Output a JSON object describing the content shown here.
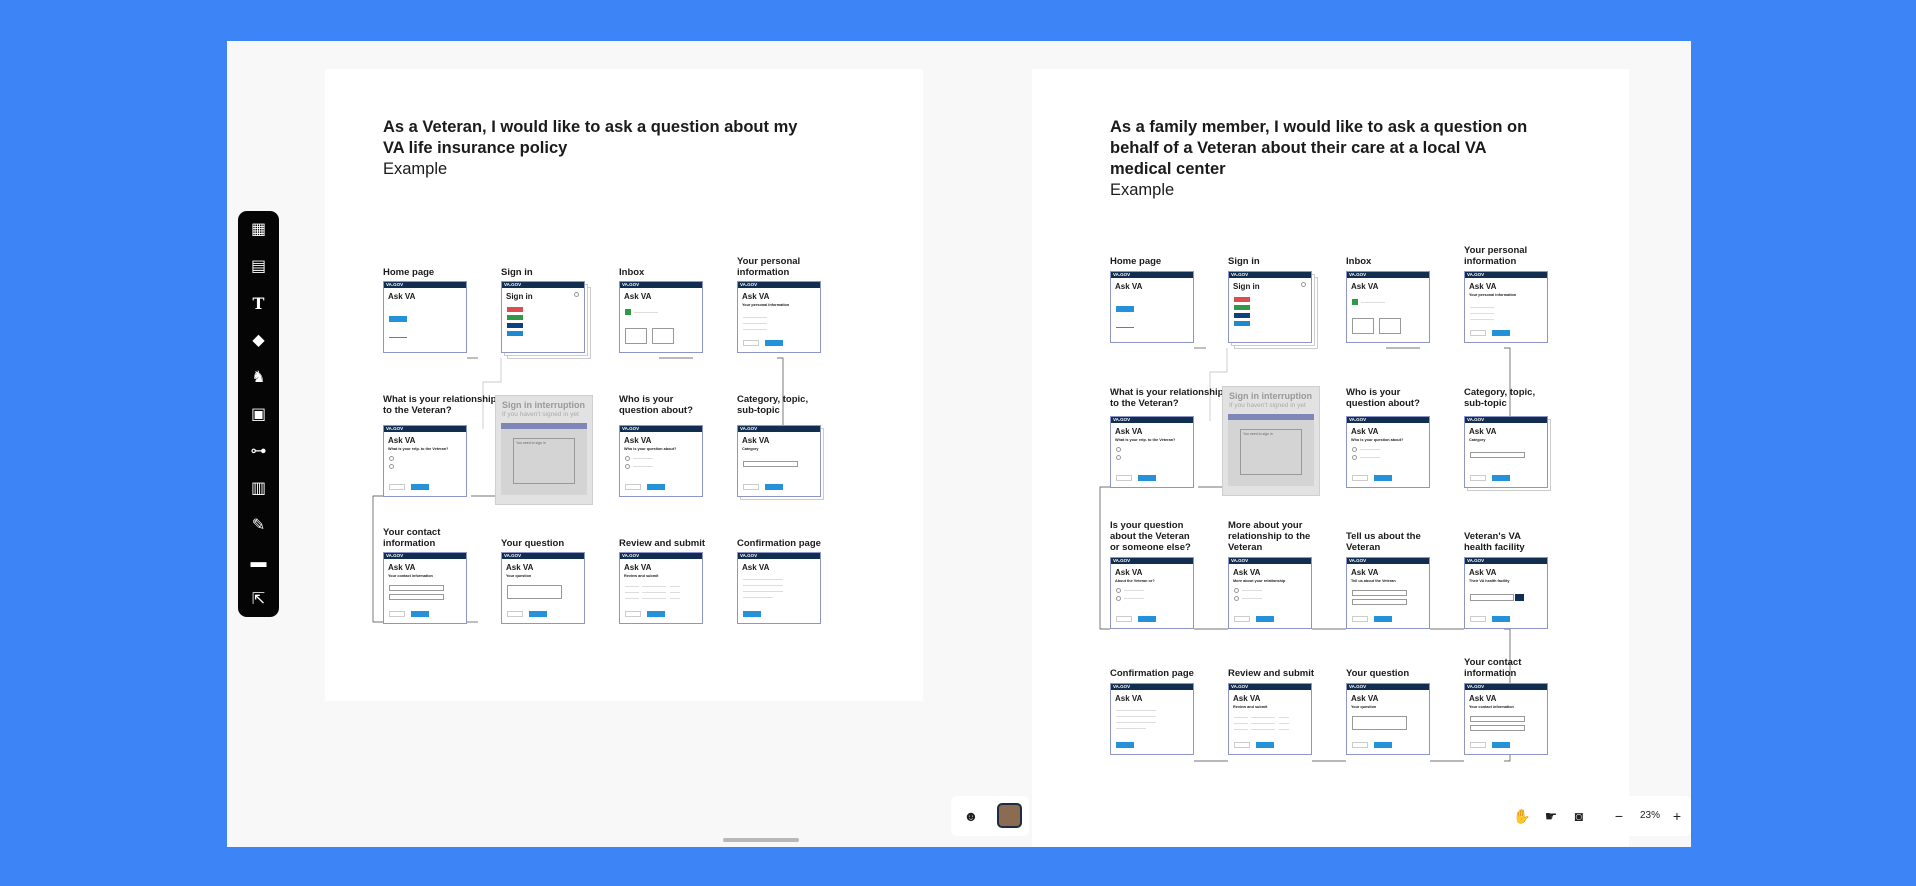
{
  "boards": {
    "left": {
      "title_line1": "As a Veteran, I would like to ask a question about my",
      "title_line2": "VA life insurance policy",
      "subtitle": "Example",
      "steps": {
        "home": "Home page",
        "signin": "Sign in",
        "inbox": "Inbox",
        "personal_1": "Your personal",
        "personal_2": "information",
        "relationship_1": "What is your relationship",
        "relationship_2": "to the Veteran?",
        "who_1": "Who is your",
        "who_2": "question about?",
        "category_1": "Category, topic,",
        "category_2": "sub-topic",
        "contact_1": "Your contact",
        "contact_2": "information",
        "question": "Your question",
        "review": "Review and submit",
        "confirmation": "Confirmation page"
      }
    },
    "right": {
      "title_line1": "As a family member, I would like to ask a question on",
      "title_line2": "behalf of a Veteran about their care at a local VA",
      "title_line3": "medical center",
      "subtitle": "Example",
      "steps": {
        "home": "Home page",
        "signin": "Sign in",
        "inbox": "Inbox",
        "personal_1": "Your personal",
        "personal_2": "information",
        "relationship_1": "What is your relationship",
        "relationship_2": "to the Veteran?",
        "who_1": "Who is your",
        "who_2": "question about?",
        "category_1": "Category, topic,",
        "category_2": "sub-topic",
        "about_1": "Is your question",
        "about_2": "about the Veteran",
        "about_3": "or someone else?",
        "more_1": "More about your",
        "more_2": "relationship to the",
        "more_3": "Veteran",
        "tell_1": "Tell us about the",
        "tell_2": "Veteran",
        "facility_1": "Veteran's VA",
        "facility_2": "health facility",
        "confirmation": "Confirmation page",
        "review": "Review and submit",
        "question": "Your question",
        "contact_1": "Your contact",
        "contact_2": "information"
      }
    }
  },
  "card": {
    "header": "VA.GOV",
    "title": "Ask VA",
    "signin_title": "Sign in",
    "sub_personal": "Your personal information",
    "sub_relationship": "What is your relp. to the Veteran?",
    "sub_who": "Who is your question about?",
    "sub_category": "Category",
    "sub_contact": "Your contact information",
    "sub_question": "Your question",
    "sub_review": "Review and submit",
    "sub_about": "About the Veteran or?",
    "sub_more": "More about your relationship",
    "sub_tell": "Tell us about the Veteran",
    "sub_facility": "Their VA health facility"
  },
  "interruption": {
    "title": "Sign in interruption",
    "subtitle": "If you haven't signed in yet",
    "note": "You need to sign in"
  },
  "toolbar": {
    "tools": [
      "templates-icon",
      "sticky-note-icon",
      "text-icon",
      "shapes-icon",
      "llama-icon",
      "image-icon",
      "diagram-icon",
      "table-icon",
      "pen-icon",
      "archive-icon",
      "export-icon"
    ]
  },
  "nav": {
    "zoom": "23%",
    "minus": "−",
    "plus": "+"
  },
  "colors": {
    "accent": "#3d84f7",
    "va_navy": "#112e51",
    "va_blue": "#2491d8"
  }
}
